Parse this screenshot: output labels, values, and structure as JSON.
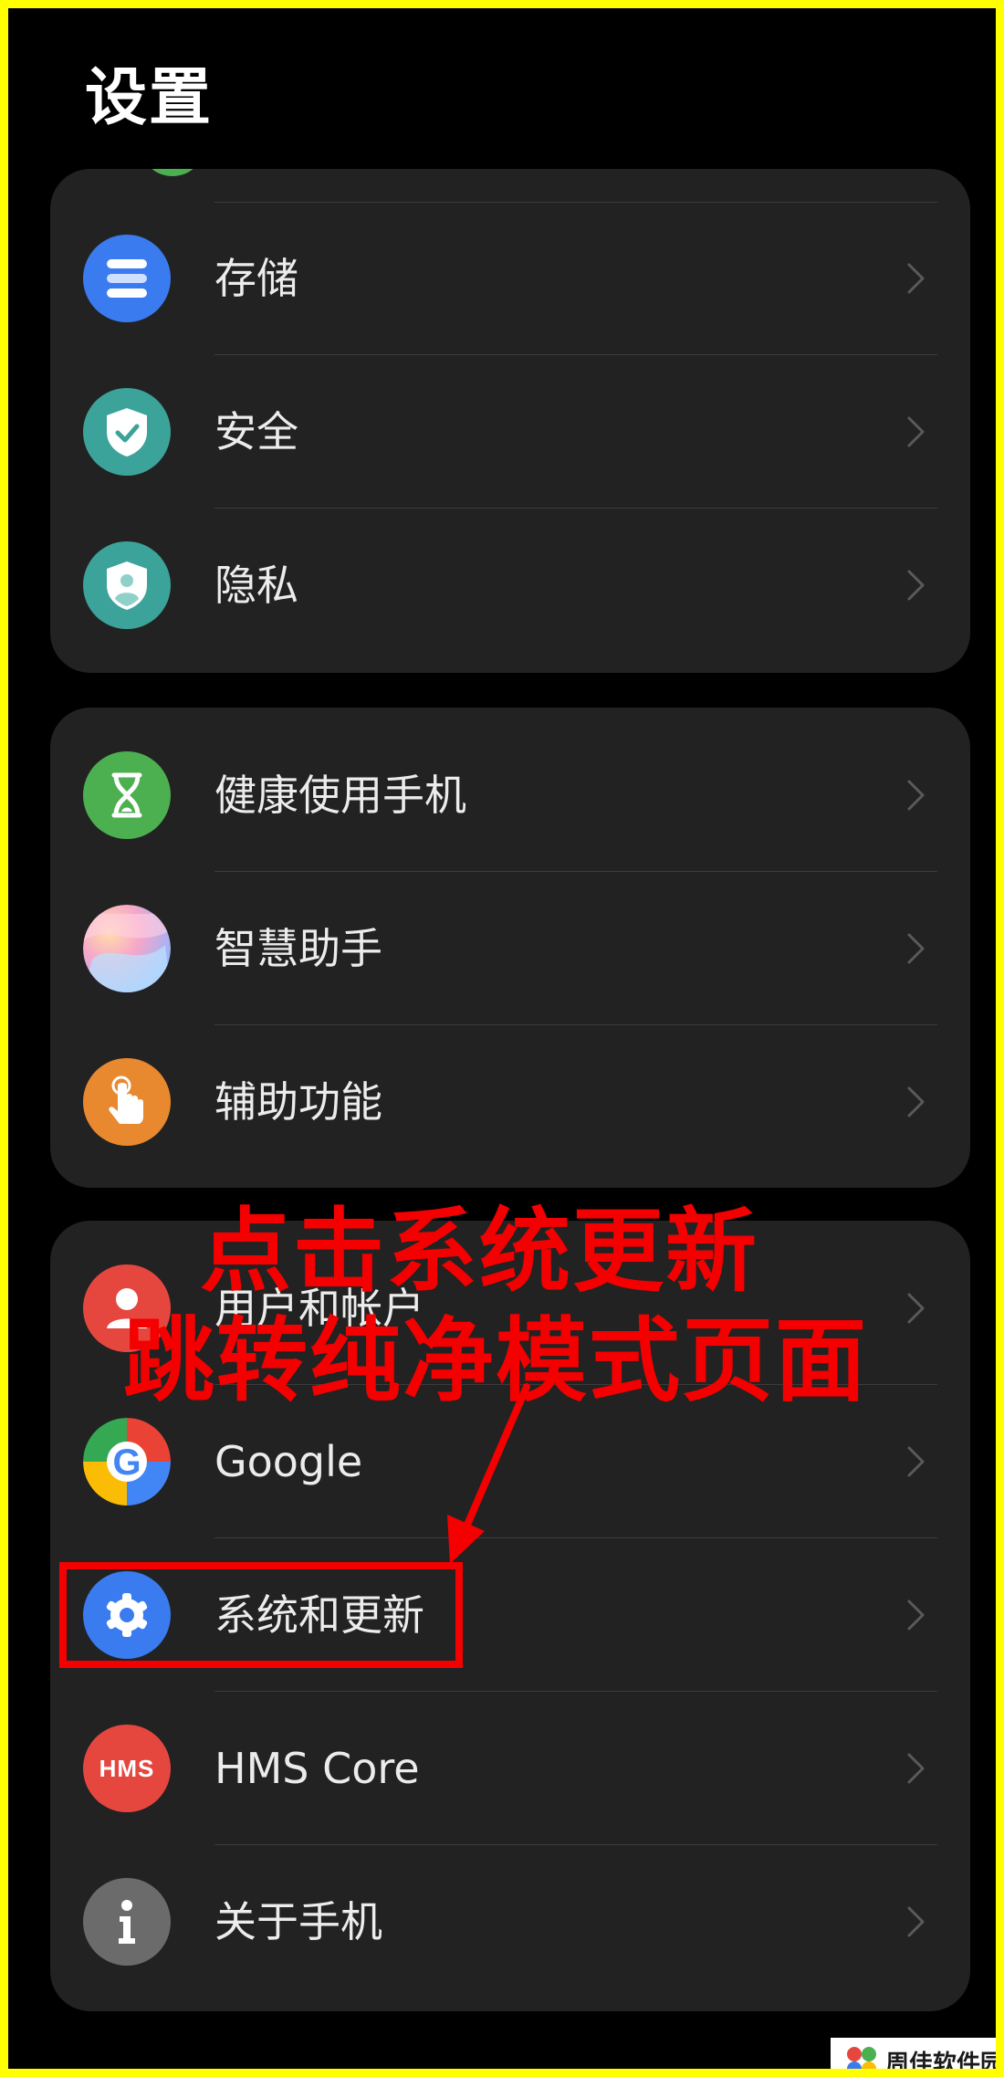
{
  "page": {
    "title": "设置"
  },
  "groups": [
    {
      "items": [
        {
          "label": "存储",
          "icon": "storage-icon",
          "color": "#3a7bef"
        },
        {
          "label": "安全",
          "icon": "security-shield-icon",
          "color": "#3ba39a"
        },
        {
          "label": "隐私",
          "icon": "privacy-shield-icon",
          "color": "#3ba39a"
        }
      ]
    },
    {
      "items": [
        {
          "label": "健康使用手机",
          "icon": "hourglass-icon",
          "color": "#4caf50"
        },
        {
          "label": "智慧助手",
          "icon": "assistant-icon",
          "color": "#d9a6e8"
        },
        {
          "label": "辅助功能",
          "icon": "accessibility-hand-icon",
          "color": "#e8892f"
        }
      ]
    },
    {
      "items": [
        {
          "label": "用户和帐户",
          "icon": "user-icon",
          "color": "#e5473f"
        },
        {
          "label": "Google",
          "icon": "google-icon",
          "color": "#ffffff"
        },
        {
          "label": "系统和更新",
          "icon": "gear-icon",
          "color": "#3a7bef"
        },
        {
          "label": "HMS Core",
          "icon": "hms-icon",
          "color": "#e5473f"
        },
        {
          "label": "关于手机",
          "icon": "info-icon",
          "color": "#6b6b6b"
        }
      ]
    }
  ],
  "hms_icon_text": "HMS",
  "annotation": {
    "line1": "点击系统更新",
    "line2": "跳转纯净模式页面",
    "color": "#f40000"
  },
  "watermark": {
    "text": "周佳软件园"
  }
}
